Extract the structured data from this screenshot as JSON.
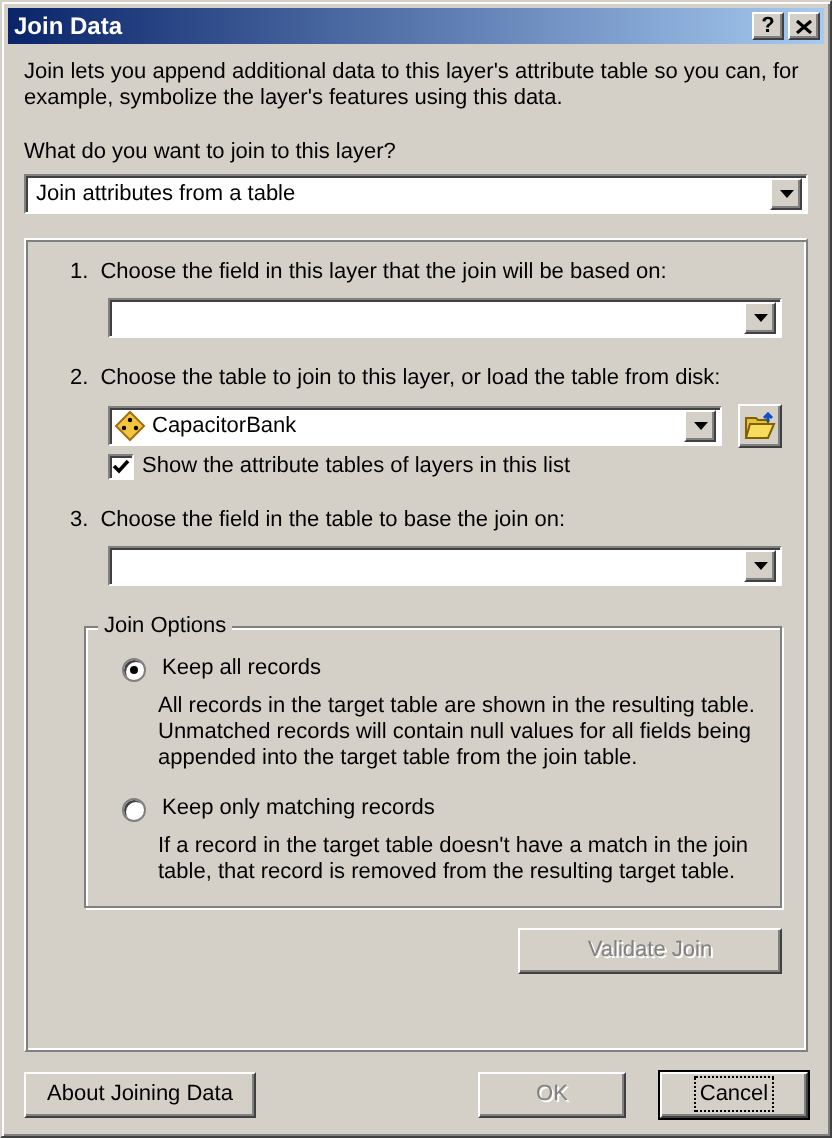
{
  "window": {
    "title": "Join Data",
    "title_buttons": [
      {
        "kind": "help",
        "label": "?"
      },
      {
        "kind": "close"
      }
    ]
  },
  "intro": "Join lets you append additional data to this layer's attribute table so you can, for example, symbolize the layer's features using this data.",
  "join_question": {
    "label": "What do you want to join to this layer?",
    "value": "Join attributes from a table"
  },
  "steps": [
    {
      "number": "1.",
      "label": "Choose the field in this layer that the join will be based on:"
    },
    {
      "number": "2.",
      "label": "Choose the table to join to this layer, or load the table from disk:",
      "value": "CapacitorBank",
      "browse": true,
      "checkbox": {
        "label": "Show the attribute tables of layers in this list",
        "checked": true
      }
    },
    {
      "number": "3.",
      "label": "Choose the field in the table to base the join on:"
    }
  ],
  "join_options": {
    "title": "Join Options",
    "options": [
      {
        "label": "Keep all records",
        "description": "All records in the target table are shown in the resulting table. Unmatched records will contain null values for all fields being appended into the target table from the join table.",
        "selected": true
      },
      {
        "label": "Keep only matching records",
        "description": "If a record in the target table doesn't have a match in the join table, that record is removed from the resulting target table.",
        "selected": false
      }
    ]
  },
  "validate_button": {
    "label": "Validate Join",
    "disabled": true
  },
  "footer_buttons": [
    {
      "label": "About Joining Data",
      "disabled": false,
      "default": false
    },
    {
      "label": "OK",
      "disabled": true,
      "default": false
    },
    {
      "label": "Cancel",
      "disabled": false,
      "default": true
    }
  ]
}
